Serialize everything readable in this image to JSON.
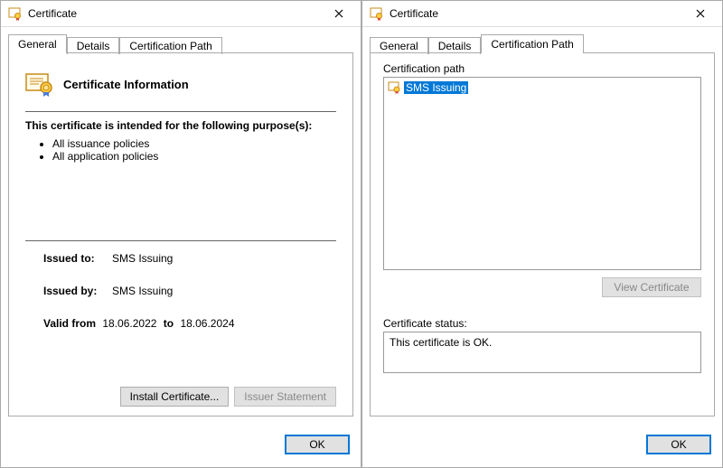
{
  "left": {
    "title": "Certificate",
    "tabs": {
      "general": "General",
      "details": "Details",
      "path": "Certification Path"
    },
    "active_tab": "general",
    "cert_info_title": "Certificate Information",
    "purpose_heading": "This certificate is intended for the following purpose(s):",
    "purposes": [
      "All issuance policies",
      "All application policies"
    ],
    "issued_to_label": "Issued to:",
    "issued_to": "SMS Issuing",
    "issued_by_label": "Issued by:",
    "issued_by": "SMS Issuing",
    "valid_from_label": "Valid from",
    "valid_from": "18.06.2022",
    "valid_to_label": "to",
    "valid_to": "18.06.2024",
    "install_button": "Install Certificate...",
    "issuer_button": "Issuer Statement",
    "ok": "OK"
  },
  "right": {
    "title": "Certificate",
    "tabs": {
      "general": "General",
      "details": "Details",
      "path": "Certification Path"
    },
    "active_tab": "path",
    "path_group_label": "Certification path",
    "tree_root": "SMS Issuing",
    "view_cert": "View Certificate",
    "status_label": "Certificate status:",
    "status_text": "This certificate is OK.",
    "ok": "OK"
  }
}
